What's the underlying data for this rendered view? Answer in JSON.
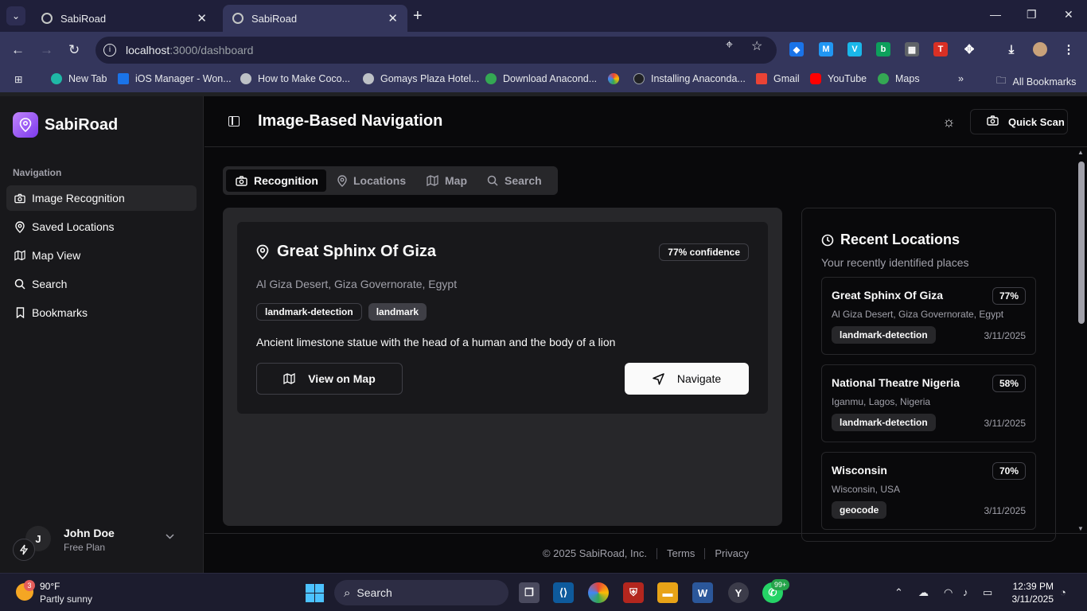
{
  "browser": {
    "tabs": [
      {
        "title": "SabiRoad",
        "close": "✕"
      },
      {
        "title": "SabiRoad",
        "close": "✕"
      }
    ],
    "new_tab": "+",
    "url_host": "localhost",
    "url_path": ":3000/dashboard",
    "bookmarks": [
      {
        "label": "New Tab",
        "color": "#1fb8a6"
      },
      {
        "label": "iOS Manager - Won...",
        "color": "#1a73e8"
      },
      {
        "label": "How to Make Coco...",
        "color": "#bdc1c6"
      },
      {
        "label": "Gomays Plaza Hotel...",
        "color": "#bdc1c6"
      },
      {
        "label": "Download Anacond...",
        "color": "#34a853"
      },
      {
        "label": "Installing Anaconda...",
        "color": "#fbbc04"
      },
      {
        "label": "Gmail",
        "color": "#ea4335"
      },
      {
        "label": "YouTube",
        "color": "#ff0000"
      },
      {
        "label": "Maps",
        "color": "#34a853"
      }
    ],
    "all_bookmarks": "All Bookmarks"
  },
  "sidebar": {
    "brand": "SabiRoad",
    "nav_heading": "Navigation",
    "items": [
      {
        "label": "Image Recognition",
        "icon": "camera-icon"
      },
      {
        "label": "Saved Locations",
        "icon": "map-pin-icon"
      },
      {
        "label": "Map View",
        "icon": "map-icon"
      },
      {
        "label": "Search",
        "icon": "search-icon"
      },
      {
        "label": "Bookmarks",
        "icon": "bookmark-icon"
      }
    ],
    "user": {
      "initial": "J",
      "name": "John Doe",
      "plan": "Free Plan"
    }
  },
  "header": {
    "title": "Image-Based Navigation",
    "quick_scan": "Quick Scan"
  },
  "tabs": [
    "Recognition",
    "Locations",
    "Map",
    "Search"
  ],
  "result": {
    "name": "Great Sphinx Of Giza",
    "confidence": "77% confidence",
    "address": "Al Giza Desert, Giza Governorate, Egypt",
    "tags": [
      "landmark-detection",
      "landmark"
    ],
    "description": "Ancient limestone statue with the head of a human and the body of a lion",
    "view_on_map": "View on Map",
    "navigate": "Navigate"
  },
  "recent": {
    "title": "Recent Locations",
    "subtitle": "Your recently identified places",
    "items": [
      {
        "name": "Great Sphinx Of Giza",
        "pct": "77%",
        "address": "Al Giza Desert, Giza Governorate, Egypt",
        "tag": "landmark-detection",
        "date": "3/11/2025"
      },
      {
        "name": "National Theatre Nigeria",
        "pct": "58%",
        "address": "Iganmu, Lagos, Nigeria",
        "tag": "landmark-detection",
        "date": "3/11/2025"
      },
      {
        "name": "Wisconsin",
        "pct": "70%",
        "address": "Wisconsin, USA",
        "tag": "geocode",
        "date": "3/11/2025"
      }
    ]
  },
  "footer": {
    "copyright": "© 2025 SabiRoad, Inc.",
    "terms": "Terms",
    "privacy": "Privacy"
  },
  "taskbar": {
    "weather_temp": "90°F",
    "weather_cond": "Partly sunny",
    "weather_badge": "3",
    "search": "Search",
    "whatsapp_badge": "99+",
    "time": "12:39 PM",
    "date": "3/11/2025"
  }
}
